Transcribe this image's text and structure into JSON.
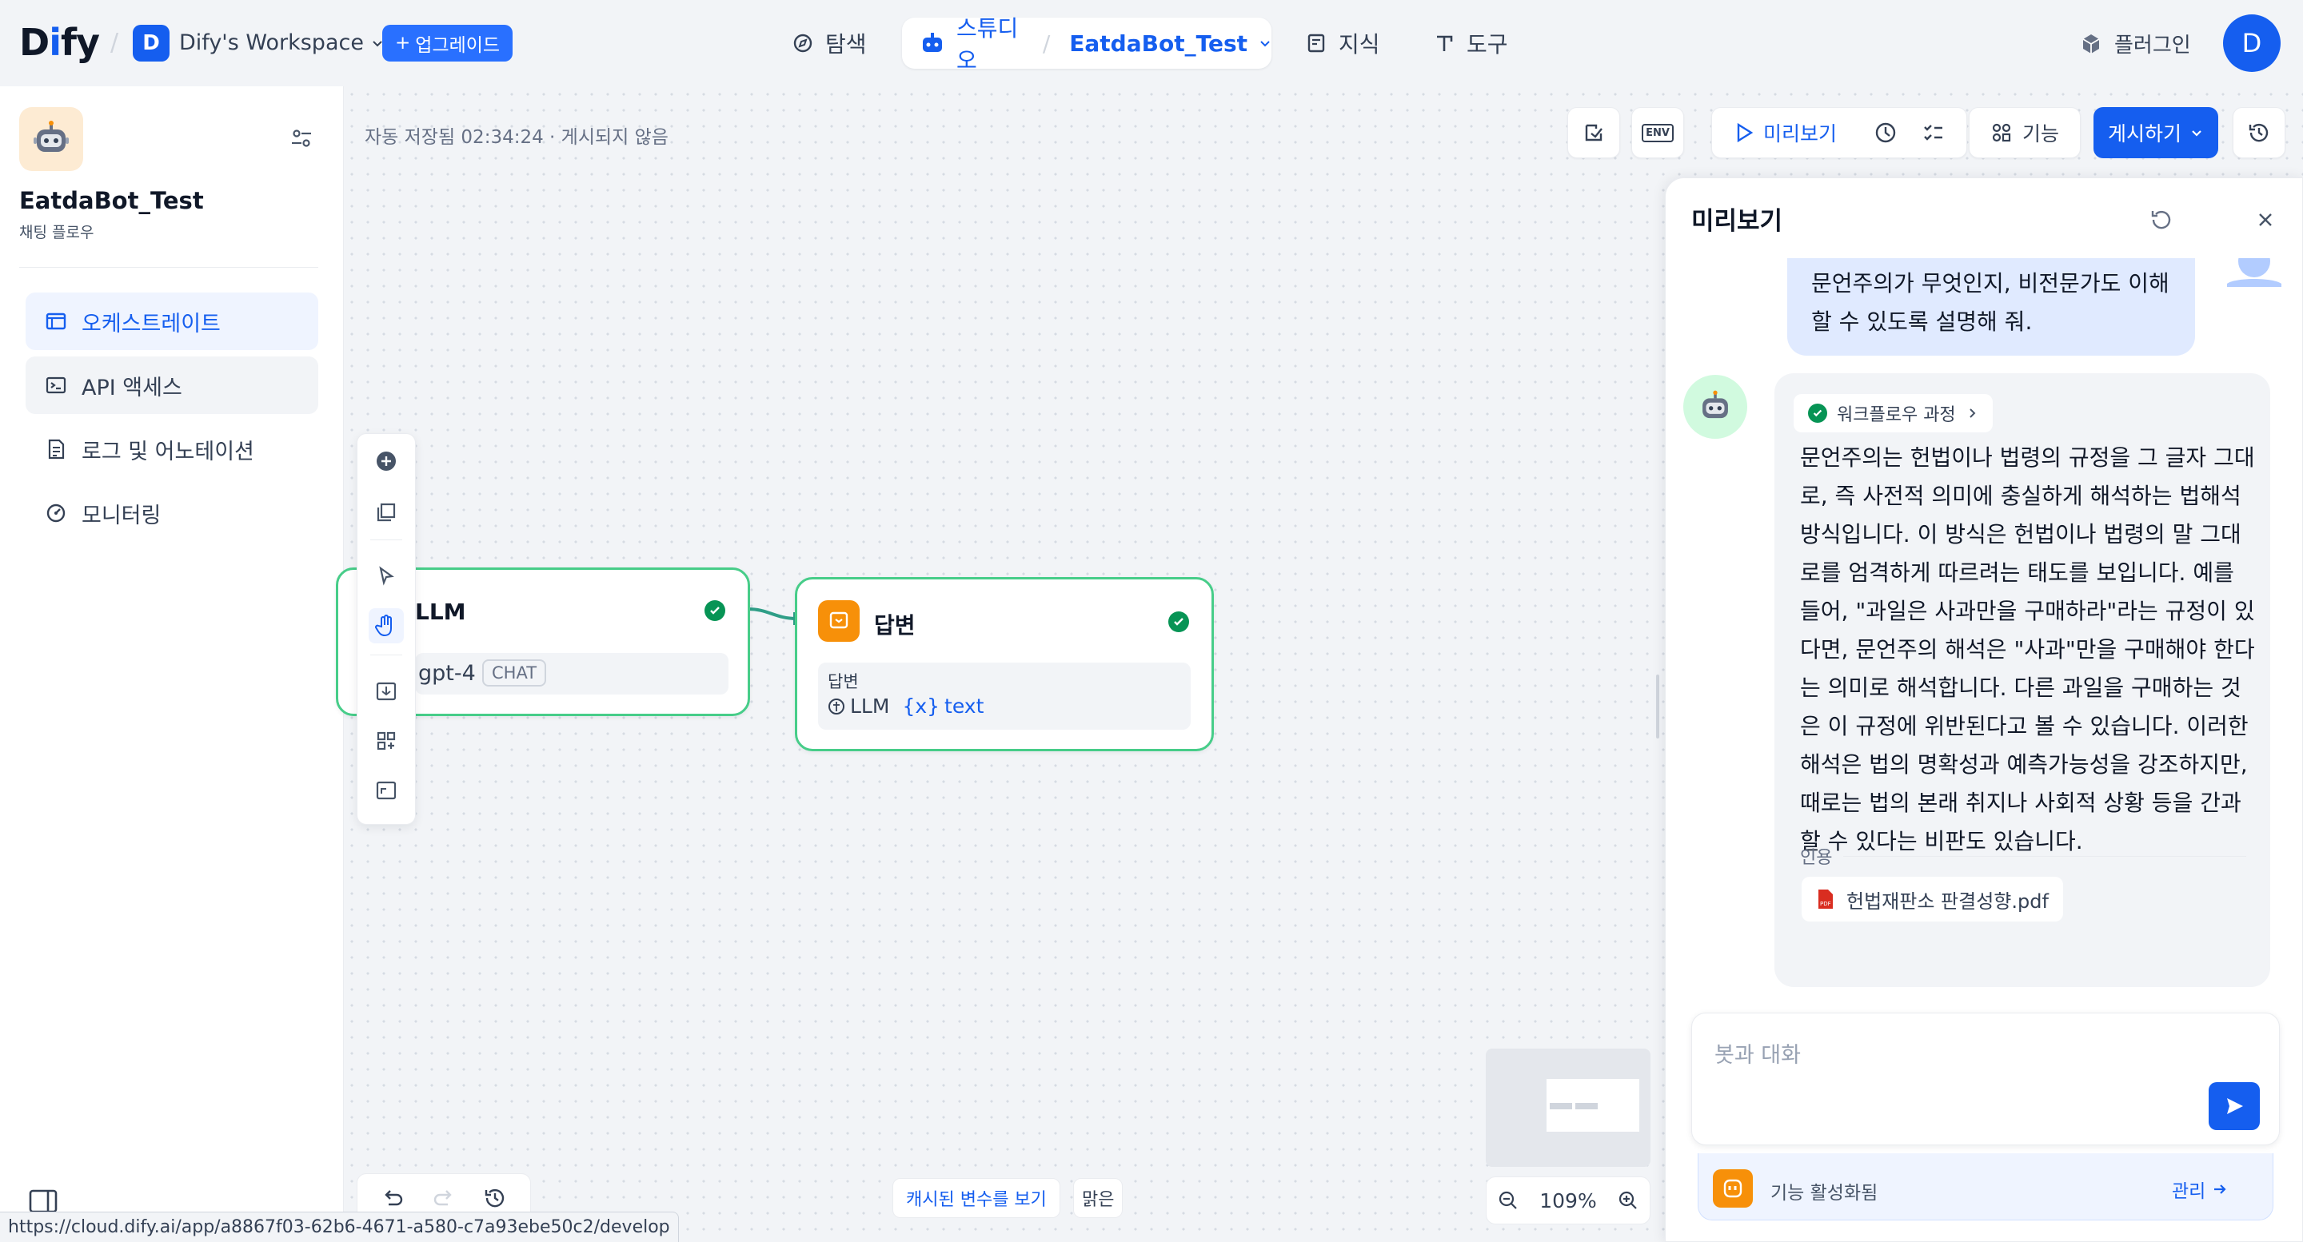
{
  "topbar": {
    "logo": "Dify",
    "workspace_initial": "D",
    "workspace_name": "Dify's Workspace",
    "upgrade_label": "업그레이드",
    "nav": {
      "explore": "탐색",
      "studio": "스튜디오",
      "knowledge": "지식",
      "tools": "도구"
    },
    "current_app": "EatdaBot_Test",
    "plugins_label": "플러그인",
    "user_initial": "D"
  },
  "sidebar": {
    "app_name": "EatdaBot_Test",
    "app_type": "채팅 플로우",
    "items": [
      {
        "label": "오케스트레이트",
        "icon": "layout-icon",
        "active": true
      },
      {
        "label": "API 액세스",
        "icon": "terminal-icon",
        "active": false
      },
      {
        "label": "로그 및 어노테이션",
        "icon": "file-list-icon",
        "active": false
      },
      {
        "label": "모니터링",
        "icon": "dashboard-icon",
        "active": false
      }
    ]
  },
  "canvas": {
    "autosave_text": "자동 저장됨 02:34:24 · 게시되지 않음",
    "toolbar": {
      "preview_label": "미리보기",
      "features_label": "기능",
      "publish_label": "게시하기",
      "env_label": "ENV"
    },
    "nodes": {
      "llm": {
        "title": "LLM",
        "model": "gpt-4",
        "mode_tag": "CHAT"
      },
      "answer": {
        "title": "답변",
        "field_label": "답변",
        "var_source": "LLM",
        "var_name": "text"
      }
    },
    "cache_label": "캐시된 변수를 보기",
    "clear_label": "맑은",
    "zoom_level": "109%"
  },
  "preview": {
    "title": "미리보기",
    "user_message": "문언주의가 무엇인지, 비전문가도 이해할 수 있도록 설명해 줘.",
    "workflow_chip": "워크플로우 과정",
    "bot_message": "문언주의는 헌법이나 법령의 규정을 그 글자 그대로, 즉 사전적 의미에 충실하게 해석하는 법해석 방식입니다. 이 방식은 헌법이나 법령의 말 그대로를 엄격하게 따르려는 태도를 보입니다. 예를 들어, \"과일은 사과만을 구매하라\"라는 규정이 있다면, 문언주의 해석은 \"사과\"만을 구매해야 한다는 의미로 해석합니다. 다른 과일을 구매하는 것은 이 규정에 위반된다고 볼 수 있습니다. 이러한 해석은 법의 명확성과 예측가능성을 강조하지만, 때로는 법의 본래 취지나 사회적 상황 등을 간과할 수 있다는 비판도 있습니다.",
    "citation_label": "인용",
    "citation_file": "헌법재판소 판결성향.pdf",
    "input_placeholder": "봇과 대화",
    "features_active": "기능 활성화됨",
    "manage_label": "관리"
  },
  "status_url": "https://cloud.dify.ai/app/a8867f03-62b6-4671-a580-c7a93ebe50c2/develop",
  "colors": {
    "accent": "#155eef",
    "node_border": "#47cd89",
    "success": "#079455",
    "answer_icon": "#f79009"
  }
}
